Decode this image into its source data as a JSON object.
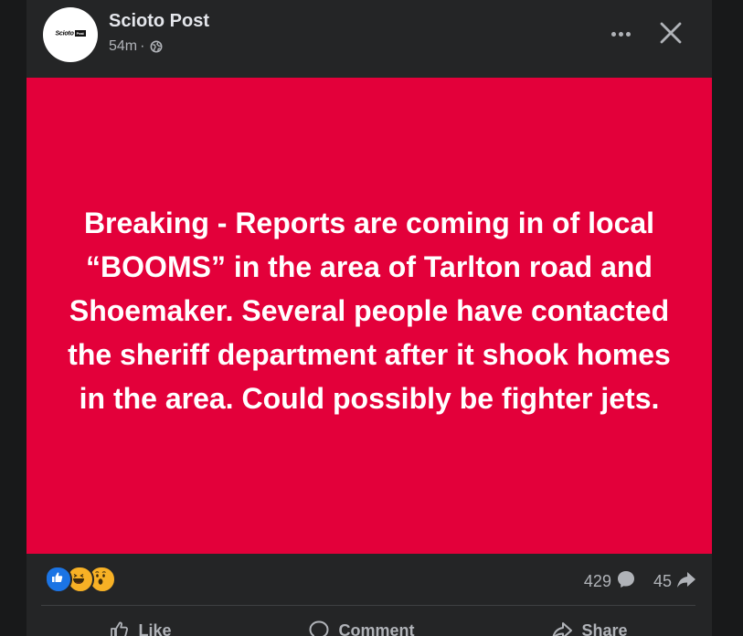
{
  "post": {
    "page_name": "Scioto Post",
    "time": "54m",
    "separator": "·",
    "avatar_text": "Scioto",
    "avatar_tag": "Post",
    "banner_text": "Breaking - Reports are coming in of local “BOOMS” in the area of Tarlton road and Shoemaker. Several people have contacted the sheriff department after it shook homes in the area. Could possibly be fighter jets.",
    "banner_color": "#e3003a"
  },
  "stats": {
    "reactions": [
      "like",
      "haha",
      "wow"
    ],
    "comments_count": "429",
    "shares_count": "45"
  },
  "actions": {
    "like_label": "Like",
    "comment_label": "Comment",
    "share_label": "Share"
  },
  "icons": {
    "globe": "globe-icon",
    "more": "more-icon",
    "close": "close-icon",
    "comment": "comment-icon",
    "share": "share-icon",
    "like": "like-icon"
  }
}
